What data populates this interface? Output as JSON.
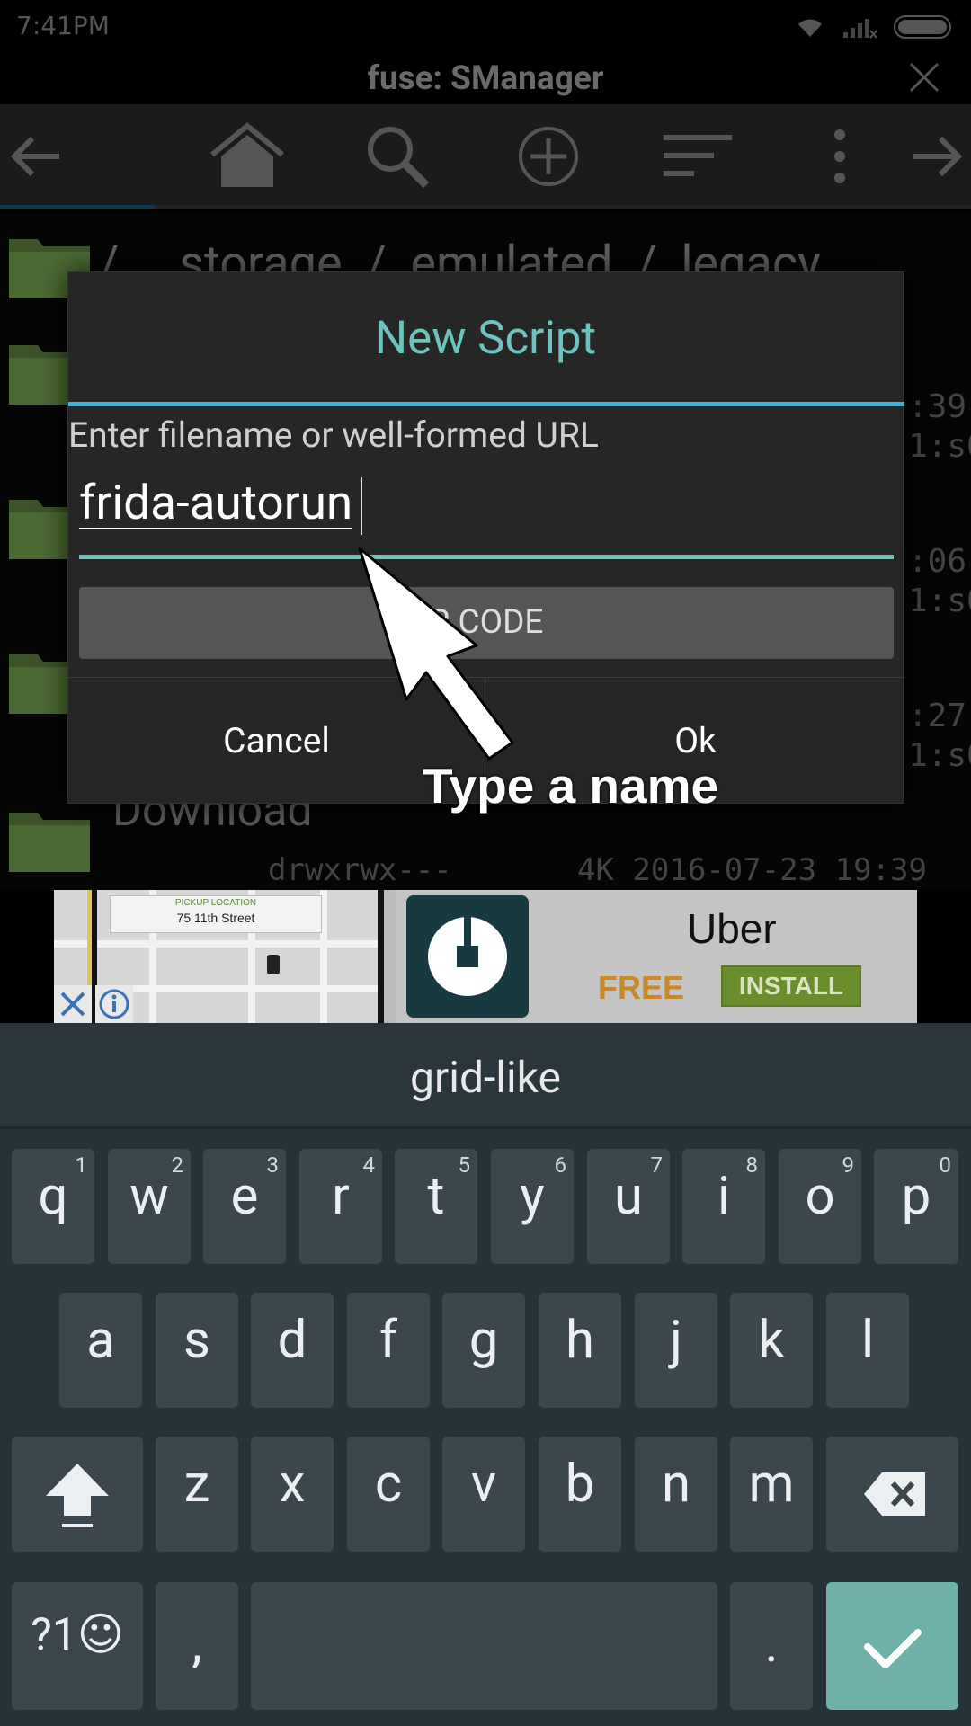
{
  "status_bar": {
    "time": "7:41PM"
  },
  "app": {
    "title": "fuse: SManager"
  },
  "toolbar": {
    "icons": [
      "back-arrow-icon",
      "home-icon",
      "search-icon",
      "add-circle-icon",
      "sort-icon",
      "overflow-menu-icon",
      "forward-arrow-icon"
    ]
  },
  "file_list": {
    "breadcrumb": "/     storage  /  emulated  /  legacy",
    "meta_fragments": [
      ":39",
      "1:s0",
      ":06",
      "1:s0",
      ":27",
      "1:s0"
    ],
    "last_folder": {
      "name": "Download",
      "permissions": "drwxrwx---",
      "info": "4K 2016-07-23 19:39"
    }
  },
  "ad": {
    "pickup_title": "PICKUP LOCATION",
    "pickup_address": "75 11th Street",
    "app_name": "Uber",
    "price": "FREE",
    "cta": "INSTALL"
  },
  "dialog": {
    "title": "New Script",
    "hint": "Enter filename or well-formed URL",
    "input_value": "frida-autorun",
    "qr_button_label": "R CODE",
    "cancel_label": "Cancel",
    "ok_label": "Ok"
  },
  "annotation": {
    "label": "Type a name"
  },
  "keyboard": {
    "suggestion": "grid-like",
    "row1": [
      {
        "k": "q",
        "h": "1"
      },
      {
        "k": "w",
        "h": "2"
      },
      {
        "k": "e",
        "h": "3"
      },
      {
        "k": "r",
        "h": "4"
      },
      {
        "k": "t",
        "h": "5"
      },
      {
        "k": "y",
        "h": "6"
      },
      {
        "k": "u",
        "h": "7"
      },
      {
        "k": "i",
        "h": "8"
      },
      {
        "k": "o",
        "h": "9"
      },
      {
        "k": "p",
        "h": "0"
      }
    ],
    "row2": [
      "a",
      "s",
      "d",
      "f",
      "g",
      "h",
      "j",
      "k",
      "l"
    ],
    "row3": [
      "z",
      "x",
      "c",
      "v",
      "b",
      "n",
      "m"
    ],
    "symbols_label": "?1☺",
    "comma": ",",
    "period": "."
  },
  "colors": {
    "accent_teal": "#6dc3bd",
    "divider_blue": "#33b5e5",
    "keyboard_bg": "#263238",
    "key_bg": "#3b474d",
    "enter_key": "#6fb0a8"
  }
}
